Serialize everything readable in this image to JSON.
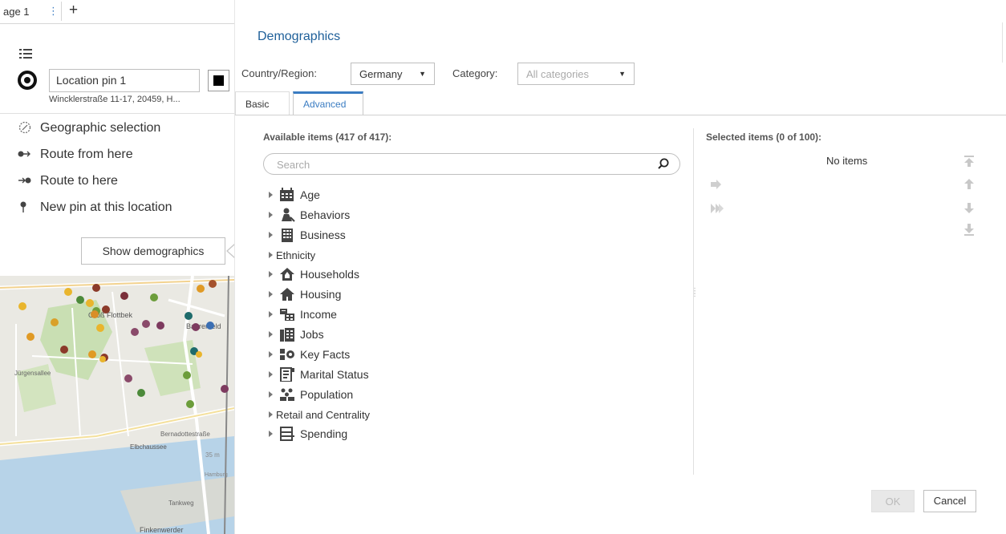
{
  "tabbar": {
    "page_tab": "age 1",
    "kebab": "⋮",
    "add": "+"
  },
  "pin": {
    "name_value": "Location pin 1",
    "address": "Wincklerstraße 11-17, 20459, H...",
    "color": "#000000"
  },
  "menu": [
    {
      "label": "Geographic selection",
      "icon": "geographic-selection-icon"
    },
    {
      "label": "Route from here",
      "icon": "route-from-icon"
    },
    {
      "label": "Route to here",
      "icon": "route-to-icon"
    },
    {
      "label": "New pin at this location",
      "icon": "pin-icon"
    }
  ],
  "show_demographics": "Show demographics",
  "map": {
    "labels": [
      "Groß Flottbek",
      "Bahrenfeld",
      "Jürgensallee",
      "Elbchaussee",
      "Bernadottestraße",
      "Tankweg",
      "Finkenwerder",
      "35 m",
      "Hamburg"
    ]
  },
  "dialog": {
    "title": "Demographics",
    "country_label": "Country/Region:",
    "country_value": "Germany",
    "category_label": "Category:",
    "category_placeholder": "All categories",
    "tabs": {
      "basic": "Basic",
      "advanced": "Advanced"
    },
    "available_title": "Available items (417 of 417):",
    "selected_title": "Selected items (0 of 100):",
    "search_placeholder": "Search",
    "no_items": "No items",
    "tree": [
      {
        "label": "Age",
        "icon": "calendar-icon"
      },
      {
        "label": "Behaviors",
        "icon": "person-icon"
      },
      {
        "label": "Business",
        "icon": "building-icon"
      },
      {
        "label": "Ethnicity",
        "icon": ""
      },
      {
        "label": "Households",
        "icon": "house-outline-icon"
      },
      {
        "label": "Housing",
        "icon": "house-icon"
      },
      {
        "label": "Income",
        "icon": "income-icon"
      },
      {
        "label": "Jobs",
        "icon": "jobs-icon"
      },
      {
        "label": "Key Facts",
        "icon": "key-facts-icon"
      },
      {
        "label": "Marital Status",
        "icon": "marital-status-icon"
      },
      {
        "label": "Population",
        "icon": "population-icon"
      },
      {
        "label": "Retail and Centrality",
        "icon": ""
      },
      {
        "label": "Spending",
        "icon": "spending-icon"
      }
    ],
    "ok": "OK",
    "cancel": "Cancel"
  }
}
